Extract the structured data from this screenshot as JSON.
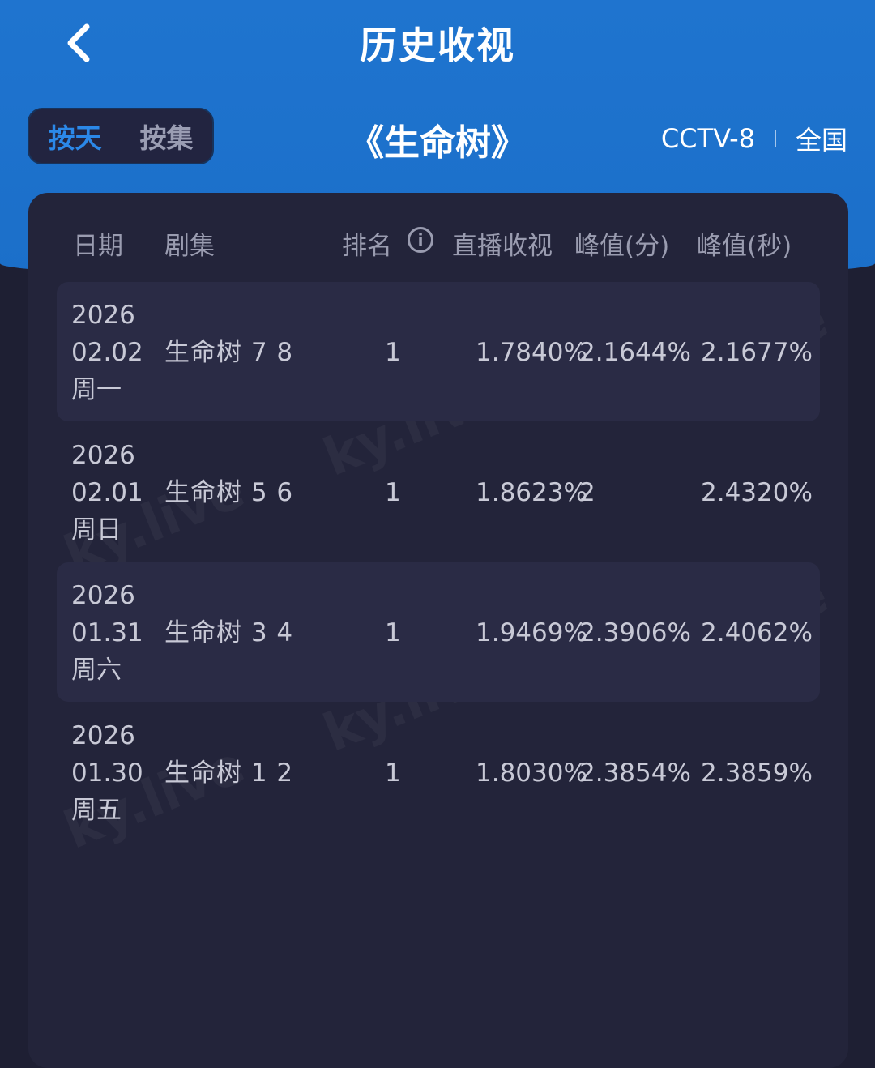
{
  "header": {
    "title": "历史收视",
    "mode_tabs": [
      "按天",
      "按集"
    ],
    "show_title": "《生命树》",
    "channel": "CCTV-8",
    "region": "全国"
  },
  "table": {
    "columns": {
      "date": "日期",
      "episode": "剧集",
      "rank": "排名",
      "live": "直播收视",
      "peak_minute": "峰值(分)",
      "peak_second": "峰值(秒)"
    },
    "rows": [
      {
        "year": "2026",
        "date": "02.02",
        "weekday": "周一",
        "episode": "生命树 7 8",
        "rank": "1",
        "live": "1.7840%",
        "peak_minute": "2.1644%",
        "peak_second": "2.1677%"
      },
      {
        "year": "2026",
        "date": "02.01",
        "weekday": "周日",
        "episode": "生命树 5 6",
        "rank": "1",
        "live": "1.8623%",
        "peak_minute": "2",
        "peak_second": "2.4320%"
      },
      {
        "year": "2026",
        "date": "01.31",
        "weekday": "周六",
        "episode": "生命树 3 4",
        "rank": "1",
        "live": "1.9469%",
        "peak_minute": "2.3906%",
        "peak_second": "2.4062%"
      },
      {
        "year": "2026",
        "date": "01.30",
        "weekday": "周五",
        "episode": "生命树 1 2",
        "rank": "1",
        "live": "1.8030%",
        "peak_minute": "2.3854%",
        "peak_second": "2.3859%"
      }
    ]
  },
  "watermark": "ky.live"
}
